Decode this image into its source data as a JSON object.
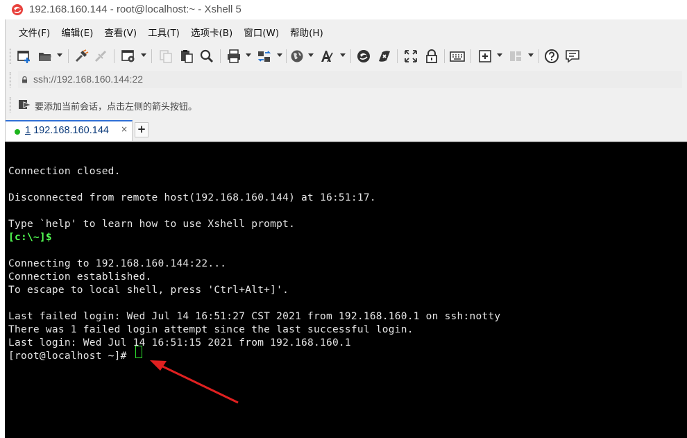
{
  "window": {
    "title": "192.168.160.144 - root@localhost:~ - Xshell 5"
  },
  "menu": [
    "文件(F)",
    "编辑(E)",
    "查看(V)",
    "工具(T)",
    "选项卡(B)",
    "窗口(W)",
    "帮助(H)"
  ],
  "toolbar": {
    "icons": [
      "new-session-icon",
      "open-folder-icon",
      "reconnect-icon",
      "disconnect-icon",
      "properties-icon",
      "copy-icon",
      "paste-icon",
      "find-icon",
      "print-icon",
      "transfer-icon",
      "globe-icon",
      "font-icon",
      "xftp-icon",
      "xmanager-icon",
      "fullscreen-icon",
      "lock-icon",
      "keyboard-icon",
      "add-tab-icon",
      "layout-icon",
      "help-icon",
      "chat-icon"
    ]
  },
  "address": {
    "value": "ssh://192.168.160.144:22"
  },
  "hint": {
    "text": "要添加当前会话，点击左侧的箭头按钮。"
  },
  "tabs": [
    {
      "number": "1",
      "label": "192.168.160.144",
      "status_color": "#1db51d",
      "active": true
    }
  ],
  "terminal": {
    "lines": [
      {
        "text": "",
        "style": "normal"
      },
      {
        "text": "Connection closed.",
        "style": "normal"
      },
      {
        "text": "",
        "style": "normal"
      },
      {
        "text": "Disconnected from remote host(192.168.160.144) at 16:51:17.",
        "style": "normal"
      },
      {
        "text": "",
        "style": "normal"
      },
      {
        "text": "Type `help' to learn how to use Xshell prompt.",
        "style": "normal"
      },
      {
        "text": "[c:\\~]$",
        "style": "green"
      },
      {
        "text": "",
        "style": "normal"
      },
      {
        "text": "Connecting to 192.168.160.144:22...",
        "style": "normal"
      },
      {
        "text": "Connection established.",
        "style": "normal"
      },
      {
        "text": "To escape to local shell, press 'Ctrl+Alt+]'.",
        "style": "normal"
      },
      {
        "text": "",
        "style": "normal"
      },
      {
        "text": "Last failed login: Wed Jul 14 16:51:27 CST 2021 from 192.168.160.1 on ssh:notty",
        "style": "normal"
      },
      {
        "text": "There was 1 failed login attempt since the last successful login.",
        "style": "normal"
      },
      {
        "text": "Last login: Wed Jul 14 16:51:15 2021 from 192.168.160.1",
        "style": "normal"
      },
      {
        "text": "[root@localhost ~]# ",
        "style": "normal"
      }
    ],
    "annotation_color": "#e02020"
  }
}
